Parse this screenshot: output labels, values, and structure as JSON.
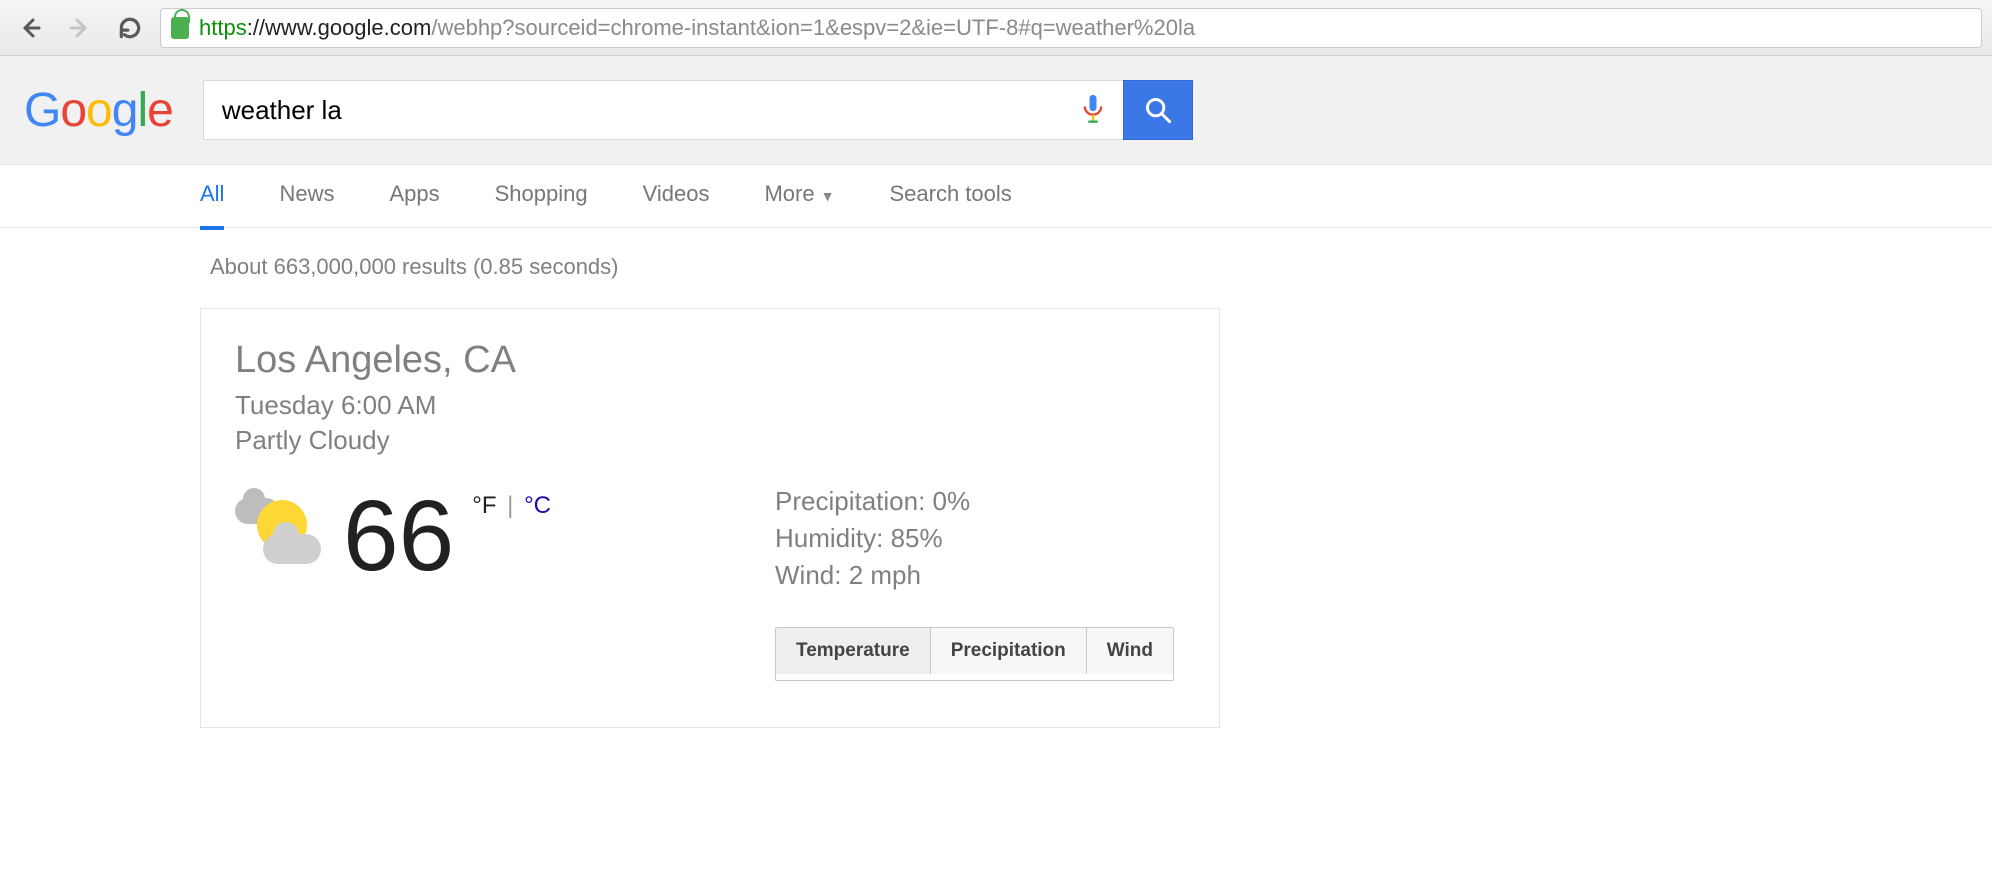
{
  "browser": {
    "url_scheme": "https",
    "url_host": "://www.google.com",
    "url_path": "/webhp?sourceid=chrome-instant&ion=1&espv=2&ie=UTF-8#q=weather%20la"
  },
  "search": {
    "query": "weather la"
  },
  "tabs": {
    "items": [
      "All",
      "News",
      "Apps",
      "Shopping",
      "Videos",
      "More",
      "Search tools"
    ],
    "active_index": 0
  },
  "stats": "About 663,000,000 results (0.85 seconds)",
  "weather": {
    "location": "Los Angeles, CA",
    "timestamp": "Tuesday 6:00 AM",
    "condition": "Partly Cloudy",
    "temperature": "66",
    "unit_active": "°F",
    "unit_sep": " | ",
    "unit_other": "°C",
    "precip_label": "Precipitation: ",
    "precip_value": "0%",
    "humidity_label": "Humidity: ",
    "humidity_value": "85%",
    "wind_label": "Wind: ",
    "wind_value": "2 mph",
    "chart_buttons": [
      "Temperature",
      "Precipitation",
      "Wind"
    ],
    "chart_active_index": 0
  }
}
